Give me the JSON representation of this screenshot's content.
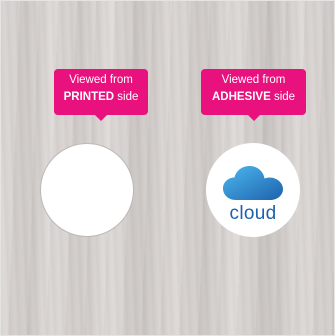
{
  "tooltips": {
    "printed": {
      "line1": "Viewed from",
      "strong": "PRINTED",
      "suffix": " side"
    },
    "adhesive": {
      "line1": "Viewed from",
      "strong": "ADHESIVE",
      "suffix": " side"
    }
  },
  "stickers": {
    "printed": {
      "state": "blank"
    },
    "adhesive": {
      "icon": "cloud-icon",
      "label": "cloud"
    }
  },
  "colors": {
    "tooltip": "#e8117d",
    "cloud_light": "#4cb9ee",
    "cloud_dark": "#1e61ad",
    "background": "#d9d4d1"
  }
}
